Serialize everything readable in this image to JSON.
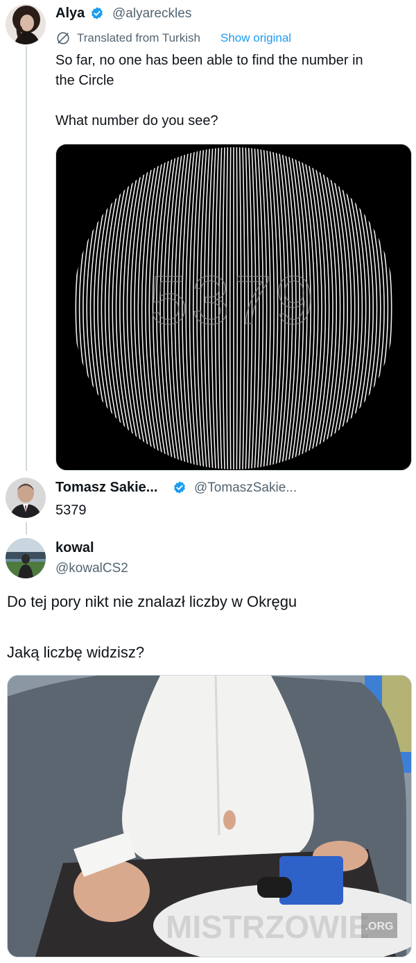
{
  "post1": {
    "name": "Alya",
    "handle": "@alyareckles",
    "translated_label": "Translated from Turkish",
    "show_original": "Show original",
    "text_line1": "So far, no one has been able to find the number in",
    "text_line2": "the Circle",
    "text_line3": "What number do you see?",
    "image_hidden_number": "5379"
  },
  "post2": {
    "name": "Tomasz Sakie...",
    "handle": "@TomaszSakie...",
    "text": "5379"
  },
  "post3": {
    "name": "kowal",
    "handle": "@kowalCS2",
    "text_line1": "Do tej pory nikt nie znalazł liczby w Okręgu",
    "text_line2": "Jaką liczbę widzisz?"
  },
  "watermark": {
    "text": "MISTRZOWIE",
    "tld": ".ORG"
  },
  "colors": {
    "verified_blue": "#1d9bf0",
    "link_blue": "#1d9bf0",
    "secondary_text": "#536471"
  }
}
